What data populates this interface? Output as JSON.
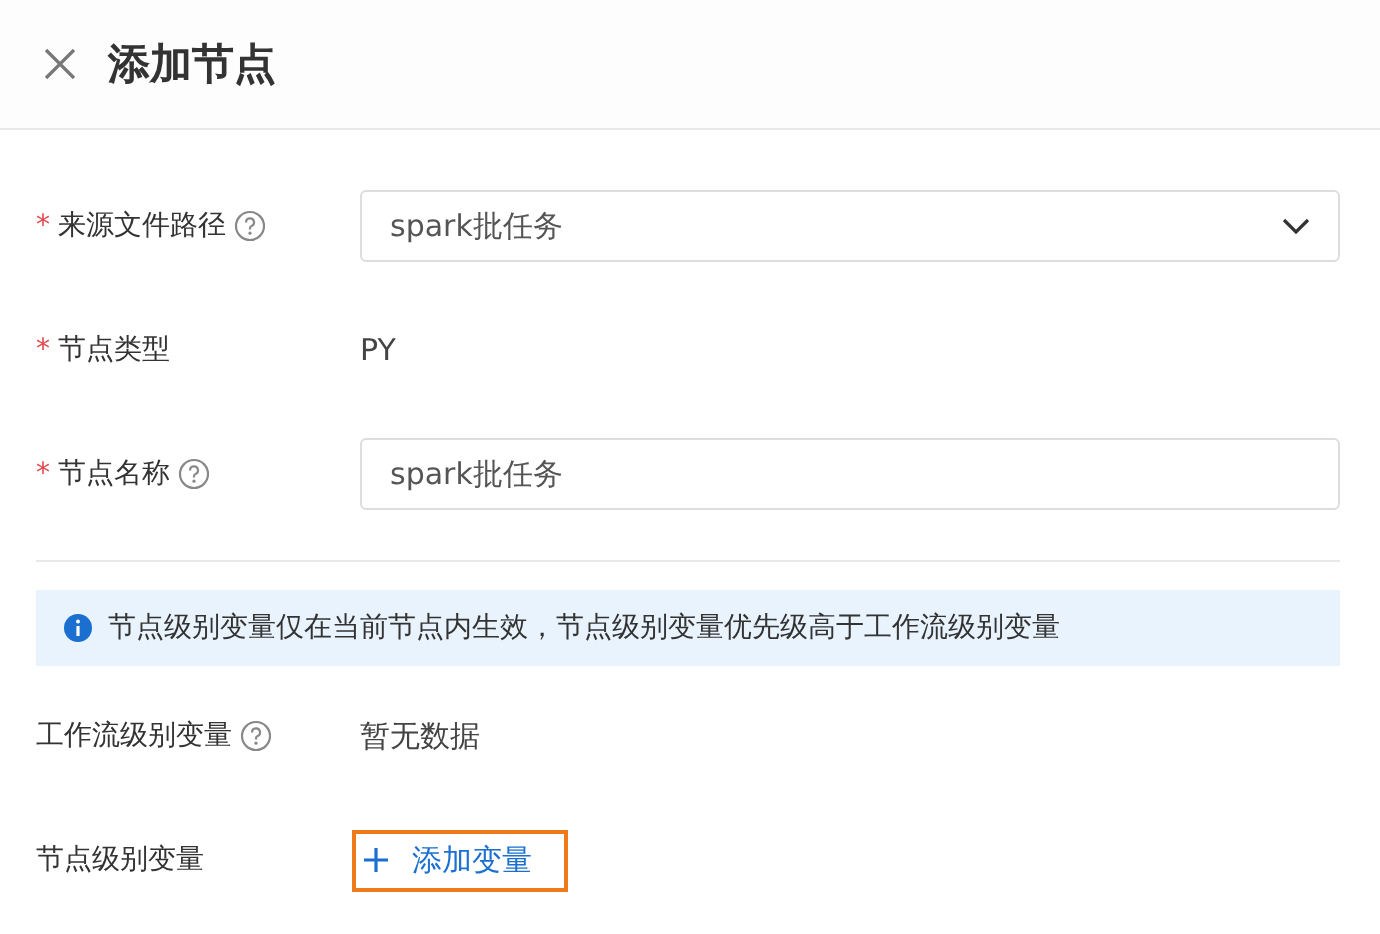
{
  "header": {
    "title": "添加节点"
  },
  "fields": [
    {
      "kind": "select",
      "required_mark": "*",
      "label": "来源文件路径",
      "help": true,
      "value": "spark批任务"
    },
    {
      "kind": "text",
      "required_mark": "*",
      "label": "节点类型",
      "help": false,
      "value": "PY"
    },
    {
      "kind": "input",
      "required_mark": "*",
      "label": "节点名称",
      "help": true,
      "value": "spark批任务"
    }
  ],
  "notice": {
    "text": "节点级别变量仅在当前节点内生效，节点级别变量优先级高于工作流级别变量"
  },
  "variables": [
    {
      "kind": "text",
      "label": "工作流级别变量",
      "help": true,
      "value": "暂无数据"
    },
    {
      "kind": "add",
      "label": "节点级别变量",
      "help": false,
      "button": "添加变量",
      "highlighted": true
    }
  ]
}
